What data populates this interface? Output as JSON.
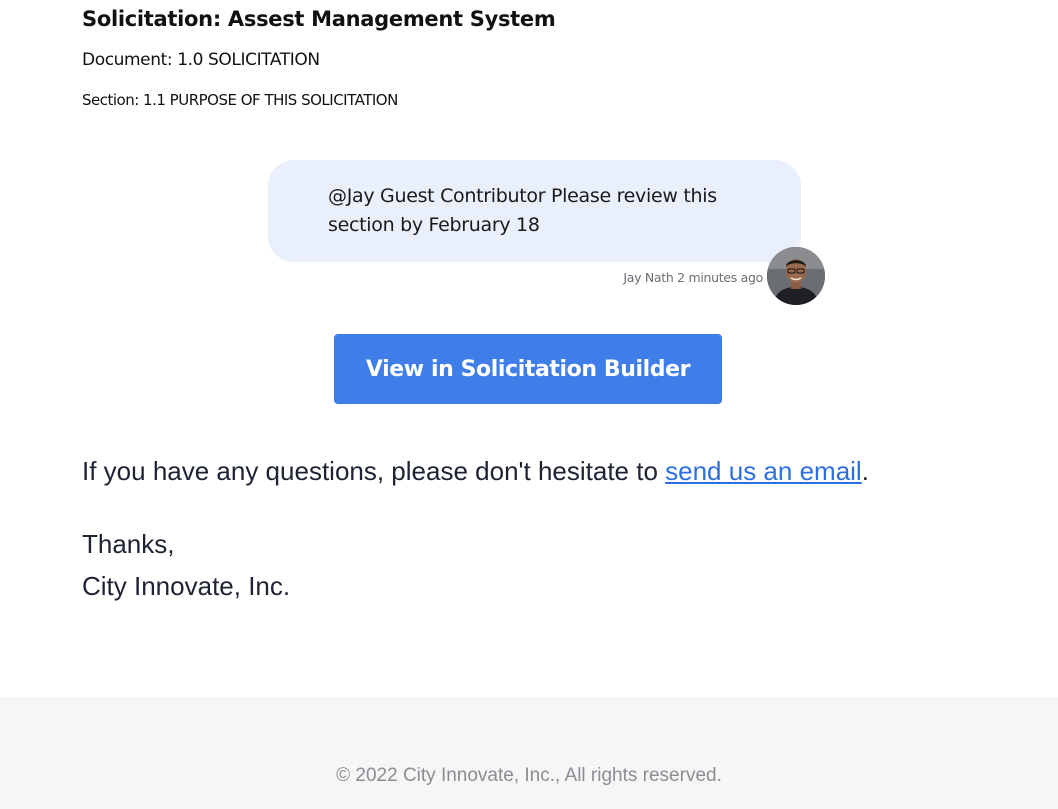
{
  "email": {
    "solicitation_title": "Solicitation: Assest Management System",
    "document_line": "Document: 1.0 SOLICITATION",
    "section_line": "Section: 1.1 PURPOSE OF THIS SOLICITATION",
    "comment": {
      "text": "@Jay Guest Contributor Please review this section by February 18",
      "author_meta": "Jay Nath 2 minutes ago",
      "avatar_icon": "user-avatar-photo",
      "bubble_color": "#eaf0fb"
    },
    "cta_button": {
      "label": "View in Solicitation Builder",
      "color": "#3f7ee8"
    },
    "questions": {
      "text_before_link": "If you have any questions, please don't hesitate to ",
      "link_text": "send us an email",
      "text_after_link": ".",
      "link_color": "#2e6fe0"
    },
    "signoff": {
      "thanks": "Thanks,",
      "company": "City Innovate, Inc."
    }
  },
  "footer": {
    "copyright": "© 2022 City Innovate, Inc., All rights reserved."
  }
}
